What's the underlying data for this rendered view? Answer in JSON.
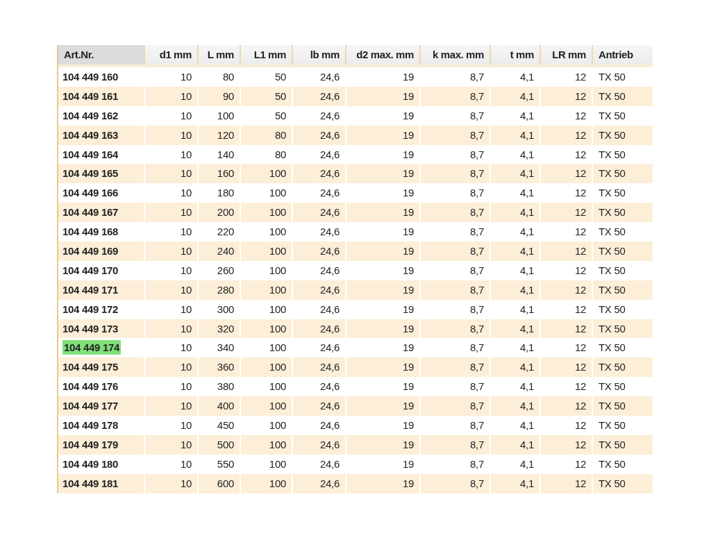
{
  "table": {
    "columns": [
      "Art.Nr.",
      "d1 mm",
      "L mm",
      "L1 mm",
      "lb mm",
      "d2 max. mm",
      "k max. mm",
      "t mm",
      "LR mm",
      "Antrieb"
    ],
    "rows": [
      {
        "highlighted": false,
        "cells": [
          "104 449 160",
          "10",
          "80",
          "50",
          "24,6",
          "19",
          "8,7",
          "4,1",
          "12",
          "TX 50"
        ]
      },
      {
        "highlighted": false,
        "cells": [
          "104 449 161",
          "10",
          "90",
          "50",
          "24,6",
          "19",
          "8,7",
          "4,1",
          "12",
          "TX 50"
        ]
      },
      {
        "highlighted": false,
        "cells": [
          "104 449 162",
          "10",
          "100",
          "50",
          "24,6",
          "19",
          "8,7",
          "4,1",
          "12",
          "TX 50"
        ]
      },
      {
        "highlighted": false,
        "cells": [
          "104 449 163",
          "10",
          "120",
          "80",
          "24,6",
          "19",
          "8,7",
          "4,1",
          "12",
          "TX 50"
        ]
      },
      {
        "highlighted": false,
        "cells": [
          "104 449 164",
          "10",
          "140",
          "80",
          "24,6",
          "19",
          "8,7",
          "4,1",
          "12",
          "TX 50"
        ]
      },
      {
        "highlighted": false,
        "cells": [
          "104 449 165",
          "10",
          "160",
          "100",
          "24,6",
          "19",
          "8,7",
          "4,1",
          "12",
          "TX 50"
        ]
      },
      {
        "highlighted": false,
        "cells": [
          "104 449 166",
          "10",
          "180",
          "100",
          "24,6",
          "19",
          "8,7",
          "4,1",
          "12",
          "TX 50"
        ]
      },
      {
        "highlighted": false,
        "cells": [
          "104 449 167",
          "10",
          "200",
          "100",
          "24,6",
          "19",
          "8,7",
          "4,1",
          "12",
          "TX 50"
        ]
      },
      {
        "highlighted": false,
        "cells": [
          "104 449 168",
          "10",
          "220",
          "100",
          "24,6",
          "19",
          "8,7",
          "4,1",
          "12",
          "TX 50"
        ]
      },
      {
        "highlighted": false,
        "cells": [
          "104 449 169",
          "10",
          "240",
          "100",
          "24,6",
          "19",
          "8,7",
          "4,1",
          "12",
          "TX 50"
        ]
      },
      {
        "highlighted": false,
        "cells": [
          "104 449 170",
          "10",
          "260",
          "100",
          "24,6",
          "19",
          "8,7",
          "4,1",
          "12",
          "TX 50"
        ]
      },
      {
        "highlighted": false,
        "cells": [
          "104 449 171",
          "10",
          "280",
          "100",
          "24,6",
          "19",
          "8,7",
          "4,1",
          "12",
          "TX 50"
        ]
      },
      {
        "highlighted": false,
        "cells": [
          "104 449 172",
          "10",
          "300",
          "100",
          "24,6",
          "19",
          "8,7",
          "4,1",
          "12",
          "TX 50"
        ]
      },
      {
        "highlighted": false,
        "cells": [
          "104 449 173",
          "10",
          "320",
          "100",
          "24,6",
          "19",
          "8,7",
          "4,1",
          "12",
          "TX 50"
        ]
      },
      {
        "highlighted": true,
        "cells": [
          "104 449 174",
          "10",
          "340",
          "100",
          "24,6",
          "19",
          "8,7",
          "4,1",
          "12",
          "TX 50"
        ]
      },
      {
        "highlighted": false,
        "cells": [
          "104 449 175",
          "10",
          "360",
          "100",
          "24,6",
          "19",
          "8,7",
          "4,1",
          "12",
          "TX 50"
        ]
      },
      {
        "highlighted": false,
        "cells": [
          "104 449 176",
          "10",
          "380",
          "100",
          "24,6",
          "19",
          "8,7",
          "4,1",
          "12",
          "TX 50"
        ]
      },
      {
        "highlighted": false,
        "cells": [
          "104 449 177",
          "10",
          "400",
          "100",
          "24,6",
          "19",
          "8,7",
          "4,1",
          "12",
          "TX 50"
        ]
      },
      {
        "highlighted": false,
        "cells": [
          "104 449 178",
          "10",
          "450",
          "100",
          "24,6",
          "19",
          "8,7",
          "4,1",
          "12",
          "TX 50"
        ]
      },
      {
        "highlighted": false,
        "cells": [
          "104 449 179",
          "10",
          "500",
          "100",
          "24,6",
          "19",
          "8,7",
          "4,1",
          "12",
          "TX 50"
        ]
      },
      {
        "highlighted": false,
        "cells": [
          "104 449 180",
          "10",
          "550",
          "100",
          "24,6",
          "19",
          "8,7",
          "4,1",
          "12",
          "TX 50"
        ]
      },
      {
        "highlighted": false,
        "cells": [
          "104 449 181",
          "10",
          "600",
          "100",
          "24,6",
          "19",
          "8,7",
          "4,1",
          "12",
          "TX 50"
        ]
      }
    ]
  }
}
